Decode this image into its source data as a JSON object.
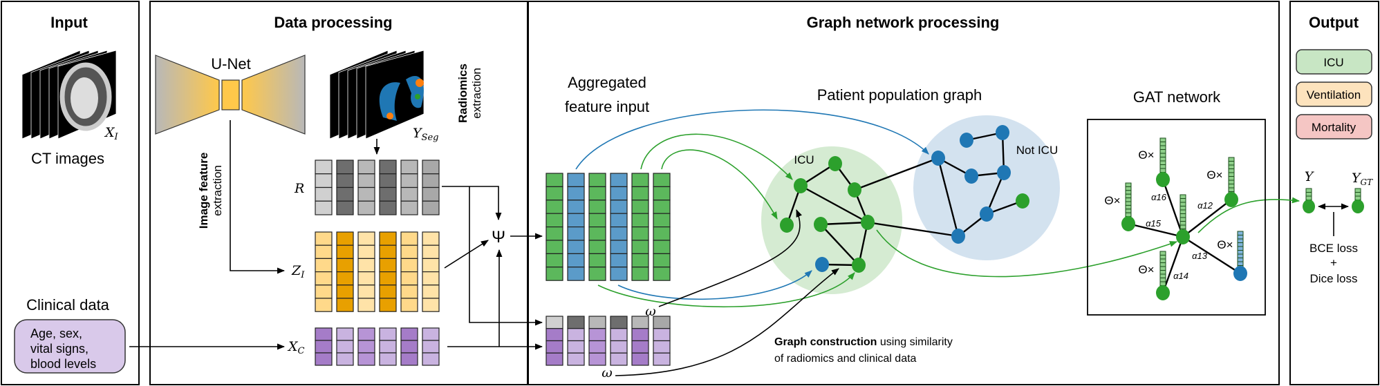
{
  "panels": {
    "input": {
      "title": "Input",
      "ct_label": "CT images",
      "x_i": "X",
      "x_i_sub": "I",
      "clinical_title": "Clinical data",
      "clinical_lines": [
        "Age, sex,",
        "vital signs,",
        "blood levels"
      ]
    },
    "data_processing": {
      "title": "Data processing",
      "unet": "U-Net",
      "y_seg": "Y",
      "y_seg_sub": "Seg",
      "radiomics_bold": "Radiomics",
      "radiomics_rest": "extraction",
      "image_feat_bold": "Image feature",
      "image_feat_rest": "extraction",
      "r": "R",
      "z_i": "Z",
      "z_i_sub": "I",
      "x_c": "X",
      "x_c_sub": "C",
      "psi": "Ψ"
    },
    "graph": {
      "title": "Graph network processing",
      "aggregated_1": "Aggregated",
      "aggregated_2": "feature input",
      "population": "Patient population graph",
      "gat": "GAT network",
      "icu": "ICU",
      "not_icu": "Not ICU",
      "omega": "ω",
      "construction_bold": "Graph construction",
      "construction_rest": " using similarity",
      "construction_line2": "of radiomics and clinical data",
      "theta": "Θ×",
      "alphas": [
        "α16",
        "α12",
        "α15",
        "α13",
        "α14"
      ]
    },
    "output": {
      "title": "Output",
      "tasks": [
        {
          "label": "ICU",
          "color": "#c8e6c4"
        },
        {
          "label": "Ventilation",
          "color": "#fde3bd"
        },
        {
          "label": "Mortality",
          "color": "#f5c6c4"
        }
      ],
      "y": "Y",
      "y_gt": "Y",
      "y_gt_sub": "GT",
      "bce": "BCE loss",
      "plus": "+",
      "dice": "Dice loss"
    }
  },
  "colors": {
    "green": "#2ca02c",
    "blue": "#1f77b4",
    "green_cell": "#5cb85c",
    "blue_cell": "#5b9bc9",
    "purple_dark": "#a57cc8",
    "purple_light": "#c9b3e0",
    "orange_dark": "#e8a000",
    "orange_light": "#ffd98a",
    "green_area": "#d5ebd2",
    "blue_area": "#d3e2ef",
    "clinical_box": "#d9c9ea"
  }
}
